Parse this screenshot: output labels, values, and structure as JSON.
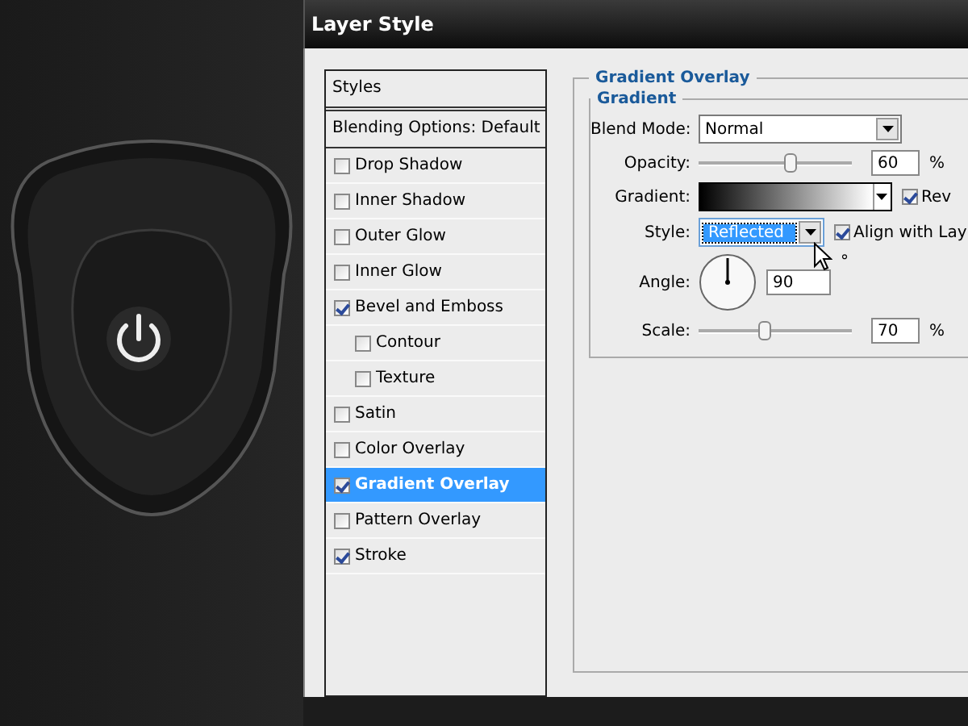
{
  "window": {
    "title": "Layer Style"
  },
  "styles_list": {
    "header": "Styles",
    "blending_options": "Blending Options: Default",
    "items": [
      {
        "label": "Drop Shadow",
        "checked": false,
        "selected": false
      },
      {
        "label": "Inner Shadow",
        "checked": false,
        "selected": false
      },
      {
        "label": "Outer Glow",
        "checked": false,
        "selected": false
      },
      {
        "label": "Inner Glow",
        "checked": false,
        "selected": false
      },
      {
        "label": "Bevel and Emboss",
        "checked": true,
        "selected": false,
        "children": [
          {
            "label": "Contour",
            "checked": false,
            "selected": false
          },
          {
            "label": "Texture",
            "checked": false,
            "selected": false
          }
        ]
      },
      {
        "label": "Satin",
        "checked": false,
        "selected": false
      },
      {
        "label": "Color Overlay",
        "checked": false,
        "selected": false
      },
      {
        "label": "Gradient Overlay",
        "checked": true,
        "selected": true
      },
      {
        "label": "Pattern Overlay",
        "checked": false,
        "selected": false
      },
      {
        "label": "Stroke",
        "checked": true,
        "selected": false
      }
    ]
  },
  "panel": {
    "title": "Gradient Overlay",
    "group_title": "Gradient",
    "blend_mode": {
      "label": "Blend Mode:",
      "value": "Normal"
    },
    "opacity": {
      "label": "Opacity:",
      "level": 0.6,
      "value": "60",
      "unit": "%"
    },
    "gradient": {
      "label": "Gradient:",
      "reverse": {
        "label": "Rev",
        "checked": true
      }
    },
    "style": {
      "label": "Style:",
      "value": "Reflected",
      "align": {
        "label": "Align with Lay",
        "checked": true
      }
    },
    "angle": {
      "label": "Angle:",
      "value": "90",
      "unit": "°"
    },
    "scale": {
      "label": "Scale:",
      "level": 0.43,
      "value": "70",
      "unit": "%"
    }
  }
}
